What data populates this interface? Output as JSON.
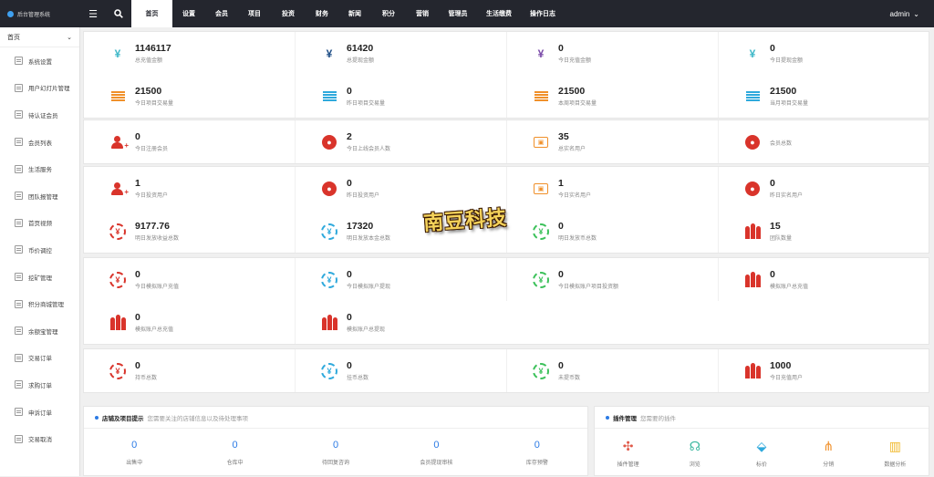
{
  "app": {
    "title": "后台管理系统"
  },
  "header": {
    "nav": [
      {
        "label": "首页"
      },
      {
        "label": "设置"
      },
      {
        "label": "会员"
      },
      {
        "label": "项目"
      },
      {
        "label": "投资"
      },
      {
        "label": "财务"
      },
      {
        "label": "新闻"
      },
      {
        "label": "积分"
      },
      {
        "label": "营销"
      },
      {
        "label": "管理员"
      },
      {
        "label": "生活缴费"
      },
      {
        "label": "操作日志"
      }
    ],
    "user": "admin"
  },
  "sidebar": {
    "head": "首页",
    "items": [
      {
        "label": "系统设置"
      },
      {
        "label": "用户幻灯片管理"
      },
      {
        "label": "待认证会员"
      },
      {
        "label": "会员列表"
      },
      {
        "label": "生活服务"
      },
      {
        "label": "团队报管理"
      },
      {
        "label": "首页视频"
      },
      {
        "label": "币价调控"
      },
      {
        "label": "挖矿管理"
      },
      {
        "label": "积分商城管理"
      },
      {
        "label": "余额宝管理"
      },
      {
        "label": "交易订单"
      },
      {
        "label": "求购订单"
      },
      {
        "label": "申诉订单"
      },
      {
        "label": "交易取消"
      }
    ]
  },
  "colors": {
    "blue": "#2c7be5",
    "teal": "#3fb8c8",
    "orange": "#f0902a",
    "red": "#d9342b",
    "purple": "#7a4aa8",
    "green": "#3cc15a",
    "sky": "#2fa9dc",
    "navy": "#1f4e86"
  },
  "panels": [
    {
      "rows": [
        [
          {
            "value": "1146117",
            "label": "总充值金额",
            "icon": "yen-icon",
            "color": "#3fb8c8"
          },
          {
            "value": "61420",
            "label": "总提现金额",
            "icon": "yen-icon",
            "color": "#1f4e86"
          },
          {
            "value": "0",
            "label": "今日充值金额",
            "icon": "yen-icon",
            "color": "#7a4aa8"
          },
          {
            "value": "0",
            "label": "今日提现金额",
            "icon": "yen-icon",
            "color": "#3fb8c8"
          }
        ],
        [
          {
            "value": "21500",
            "label": "今日项目交易量",
            "icon": "list-icon",
            "color": "#f0902a"
          },
          {
            "value": "0",
            "label": "昨日项目交易量",
            "icon": "list-icon",
            "color": "#2fa9dc"
          },
          {
            "value": "21500",
            "label": "本周项目交易量",
            "icon": "list-icon",
            "color": "#f0902a"
          },
          {
            "value": "21500",
            "label": "当月项目交易量",
            "icon": "list-icon",
            "color": "#2fa9dc"
          }
        ]
      ]
    },
    {
      "rows": [
        [
          {
            "value": "0",
            "label": "今日注册会员",
            "icon": "user-add-icon",
            "color": "#d9342b"
          },
          {
            "value": "2",
            "label": "今日上线会员人数",
            "icon": "user-circle-icon",
            "color": "#d9342b"
          },
          {
            "value": "35",
            "label": "总实名用户",
            "icon": "id-card-icon",
            "color": "#f0902a"
          },
          {
            "value": "",
            "label": "会员总数",
            "icon": "user-circle-icon",
            "color": "#d9342b"
          }
        ]
      ]
    },
    {
      "rows": [
        [
          {
            "value": "1",
            "label": "今日投资用户",
            "icon": "user-add-icon",
            "color": "#d9342b"
          },
          {
            "value": "0",
            "label": "昨日投资用户",
            "icon": "user-circle-icon",
            "color": "#d9342b"
          },
          {
            "value": "1",
            "label": "今日实名用户",
            "icon": "id-card-icon",
            "color": "#f0902a"
          },
          {
            "value": "0",
            "label": "昨日实名用户",
            "icon": "user-circle-icon",
            "color": "#d9342b"
          }
        ],
        [
          {
            "value": "9177.76",
            "label": "明日发放收益总数",
            "icon": "yen-ring-icon",
            "color": "#d9342b"
          },
          {
            "value": "17320",
            "label": "明日发放本金总数",
            "icon": "yen-ring-icon",
            "color": "#2fa9dc"
          },
          {
            "value": "0",
            "label": "明日发放币总数",
            "icon": "yen-ring-icon",
            "color": "#3cc15a"
          },
          {
            "value": "15",
            "label": "团队数量",
            "icon": "group-icon",
            "color": "#d9342b"
          }
        ]
      ]
    },
    {
      "rows": [
        [
          {
            "value": "0",
            "label": "今日模拟账户充值",
            "icon": "yen-ring-icon",
            "color": "#d9342b"
          },
          {
            "value": "0",
            "label": "今日模拟账户提现",
            "icon": "yen-ring-icon",
            "color": "#2fa9dc"
          },
          {
            "value": "0",
            "label": "今日模拟账户项目投资额",
            "icon": "yen-ring-icon",
            "color": "#3cc15a"
          },
          {
            "value": "0",
            "label": "模拟账户总充值",
            "icon": "group-icon",
            "color": "#d9342b"
          }
        ],
        [
          {
            "value": "0",
            "label": "模拟账户总充值",
            "icon": "group-icon",
            "color": "#d9342b"
          },
          {
            "value": "0",
            "label": "模拟账户总提现",
            "icon": "group-icon",
            "color": "#d9342b"
          }
        ]
      ]
    },
    {
      "rows": [
        [
          {
            "value": "0",
            "label": "持币总数",
            "icon": "yen-ring-icon",
            "color": "#d9342b"
          },
          {
            "value": "0",
            "label": "挂币总数",
            "icon": "yen-ring-icon",
            "color": "#2fa9dc"
          },
          {
            "value": "0",
            "label": "未提币数",
            "icon": "yen-ring-icon",
            "color": "#3cc15a"
          },
          {
            "value": "1000",
            "label": "今日充值用户",
            "icon": "group-icon",
            "color": "#d9342b"
          }
        ]
      ]
    }
  ],
  "store": {
    "title": "店铺及项目提示",
    "subtitle": "您需要关注的店铺信息以及待处理事项",
    "stats": [
      {
        "value": "0",
        "label": "出售中"
      },
      {
        "value": "0",
        "label": "仓库中"
      },
      {
        "value": "0",
        "label": "待回复咨询"
      },
      {
        "value": "0",
        "label": "会员提现审核"
      },
      {
        "value": "0",
        "label": "库存预警"
      }
    ]
  },
  "plugins": {
    "title": "插件管理",
    "subtitle": "您需要的插件",
    "items": [
      {
        "label": "插件管理",
        "glyph": "✣",
        "color": "#e05a4a"
      },
      {
        "label": "浏览",
        "glyph": "☊",
        "color": "#3cb8a0"
      },
      {
        "label": "标价",
        "glyph": "⬙",
        "color": "#2fa9dc"
      },
      {
        "label": "分销",
        "glyph": "⋔",
        "color": "#f0902a"
      },
      {
        "label": "数据分析",
        "glyph": "▥",
        "color": "#f0b82a"
      }
    ]
  },
  "logo_text": "南豆科技"
}
